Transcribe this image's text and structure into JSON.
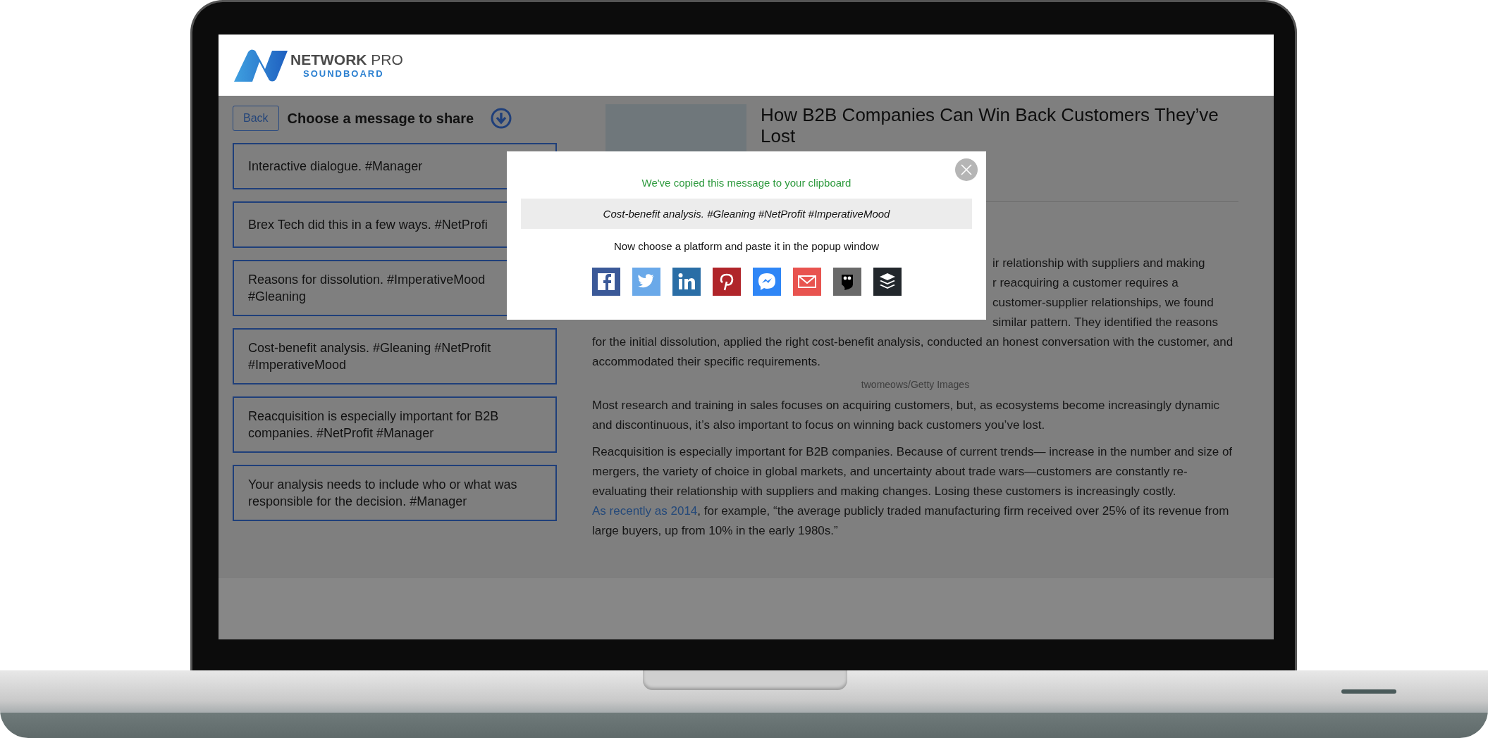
{
  "header": {
    "logo": {
      "name": "NETWORK",
      "suffix": "PRO",
      "tagline": "SOUNDBOARD"
    }
  },
  "messages_panel": {
    "back": "Back",
    "title": "Choose a message to share",
    "messages": [
      {
        "text": "Interactive dialogue. #Manager"
      },
      {
        "text": "Brex Tech did this in a few ways. #NetProfi"
      },
      {
        "text": "Reasons for dissolution. #ImperativeMood #Gleaning"
      },
      {
        "text": "Cost-benefit analysis. #Gleaning #NetProfit #ImperativeMood"
      },
      {
        "text": "Reacquisition is especially important for B2B companies. #NetProfit #Manager"
      },
      {
        "text": "Your analysis needs to include who or what was responsible for the decision. #Manager"
      }
    ]
  },
  "article": {
    "title": "How B2B Companies Can Win Back Customers They’ve Lost",
    "body": [
      {
        "kind": "partial",
        "lines": [
          "ir relationship with suppliers and making",
          "r reacquiring a customer requires a",
          "customer-supplier relationships, we found",
          "similar pattern. They identified the reasons"
        ]
      },
      {
        "kind": "paragraph",
        "parts": [
          {
            "text": "for the initial dissolution, applied the right cost-benefit analysis, conducted an honest conversation with the customer, and accommodated their specific requirements.",
            "link": false
          }
        ]
      },
      {
        "kind": "caption",
        "text": "twomeows/Getty Images"
      },
      {
        "kind": "paragraph",
        "parts": [
          {
            "text": "Most research and training in sales focuses on acquiring customers, but, as ecosystems become increasingly dynamic and discontinuous, it’s also important to focus on winning back customers you’ve lost.",
            "link": false
          }
        ]
      },
      {
        "kind": "paragraph",
        "parts": [
          {
            "text": "Reacquisition is especially important for B2B companies. Because of current trends— increase in the number and size of mergers, the variety of choice in global markets, and uncertainty about trade wars—customers are constantly re-evaluating their relationship with suppliers and making changes. Losing these customers is increasingly costly. ",
            "link": false
          },
          {
            "text": "As recently as 2014",
            "link": true
          },
          {
            "text": ", for example, “the average publicly traded manufacturing firm received over 25% of its revenue from large buyers, up from 10% in the early 1980s.”",
            "link": false
          }
        ]
      }
    ]
  },
  "modal": {
    "notice": "We've copied this message to your clipboard",
    "message": "Cost-benefit analysis. #Gleaning #NetProfit #ImperativeMood",
    "instruction": "Now choose a platform and paste it in the popup window",
    "platforms": [
      {
        "kind": "facebook",
        "color": "#3b5998"
      },
      {
        "kind": "twitter",
        "color": "#6aa9e9"
      },
      {
        "kind": "linkedin",
        "color": "#2a6ea6"
      },
      {
        "kind": "pinterest",
        "color": "#b0252a"
      },
      {
        "kind": "messenger",
        "color": "#2f86f6"
      },
      {
        "kind": "email",
        "color": "#e8534f"
      },
      {
        "kind": "owl",
        "color": "#6a6a6a"
      },
      {
        "kind": "layers",
        "color": "#22272c"
      }
    ]
  }
}
